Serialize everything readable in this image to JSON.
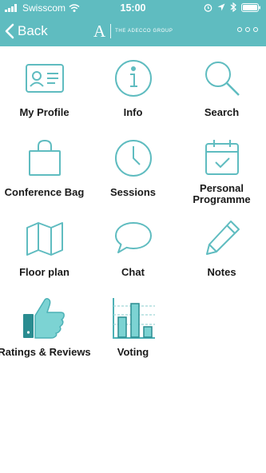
{
  "status": {
    "carrier": "Swisscom",
    "time": "15:00",
    "icons": [
      "signal-bars",
      "wifi",
      "alarm",
      "location-arrow",
      "bluetooth",
      "battery"
    ]
  },
  "nav": {
    "back_label": "Back",
    "brand_mark": "A",
    "brand_text": "THE ADECCO GROUP",
    "more_icon": "ellipsis"
  },
  "colors": {
    "accent": "#5fbcc0",
    "icon_stroke": "#5fbcc0",
    "icon_fill": "#4cb1b6"
  },
  "tiles": [
    {
      "label": "My Profile",
      "icon": "id-card-icon"
    },
    {
      "label": "Info",
      "icon": "info-icon"
    },
    {
      "label": "Search",
      "icon": "search-icon"
    },
    {
      "label": "Conference Bag",
      "icon": "bag-icon"
    },
    {
      "label": "Sessions",
      "icon": "clock-icon"
    },
    {
      "label": "Personal Programme",
      "icon": "calendar-check-icon"
    },
    {
      "label": "Floor plan",
      "icon": "map-icon"
    },
    {
      "label": "Chat",
      "icon": "chat-bubble-icon"
    },
    {
      "label": "Notes",
      "icon": "pencil-icon"
    },
    {
      "label": "Ratings & Reviews",
      "icon": "thumbs-up-icon"
    },
    {
      "label": "Voting",
      "icon": "bar-chart-icon"
    }
  ]
}
